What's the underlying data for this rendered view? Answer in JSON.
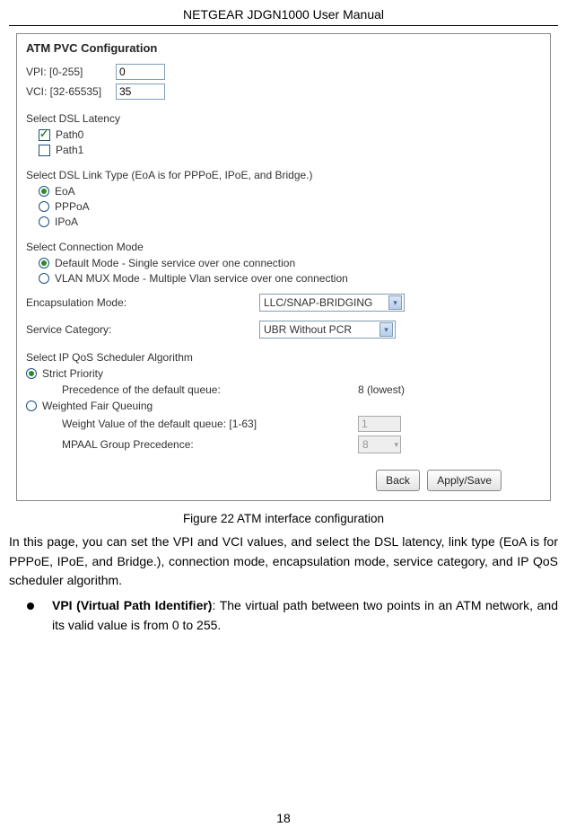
{
  "header": "NETGEAR JDGN1000 User Manual",
  "screenshot": {
    "title": "ATM PVC Configuration",
    "vpi_label": "VPI: [0-255]",
    "vpi_value": "0",
    "vci_label": "VCI: [32-65535]",
    "vci_value": "35",
    "dsl_latency_label": "Select DSL Latency",
    "path0": "Path0",
    "path1": "Path1",
    "dsl_link_label": "Select DSL Link Type (EoA is for PPPoE, IPoE, and Bridge.)",
    "link_eoa": "EoA",
    "link_pppoa": "PPPoA",
    "link_ipoa": "IPoA",
    "conn_mode_label": "Select Connection Mode",
    "conn_default": "Default Mode - Single service over one connection",
    "conn_vlan": "VLAN MUX Mode - Multiple Vlan service over one connection",
    "encap_label": "Encapsulation Mode:",
    "encap_value": "LLC/SNAP-BRIDGING",
    "svc_cat_label": "Service Category:",
    "svc_cat_value": "UBR Without PCR",
    "qos_label": "Select IP QoS Scheduler Algorithm",
    "qos_strict": "Strict Priority",
    "qos_precedence_label": "Precedence of the default queue:",
    "qos_precedence_value": "8 (lowest)",
    "qos_wfq": "Weighted Fair Queuing",
    "qos_weight_label": "Weight Value of the default queue: [1-63]",
    "qos_weight_value": "1",
    "qos_mpaal_label": "MPAAL Group Precedence:",
    "qos_mpaal_value": "8",
    "btn_back": "Back",
    "btn_apply": "Apply/Save"
  },
  "caption": "Figure 22 ATM interface configuration",
  "paragraph": "In this page, you can set the VPI and VCI values, and select the DSL latency, link type (EoA is for PPPoE, IPoE, and Bridge.), connection mode, encapsulation mode, service category, and IP QoS scheduler algorithm.",
  "bullet_bold": "VPI (Virtual Path Identifier)",
  "bullet_rest": ": The virtual path between two points in an ATM network, and its valid value is from 0 to 255.",
  "page_number": "18"
}
